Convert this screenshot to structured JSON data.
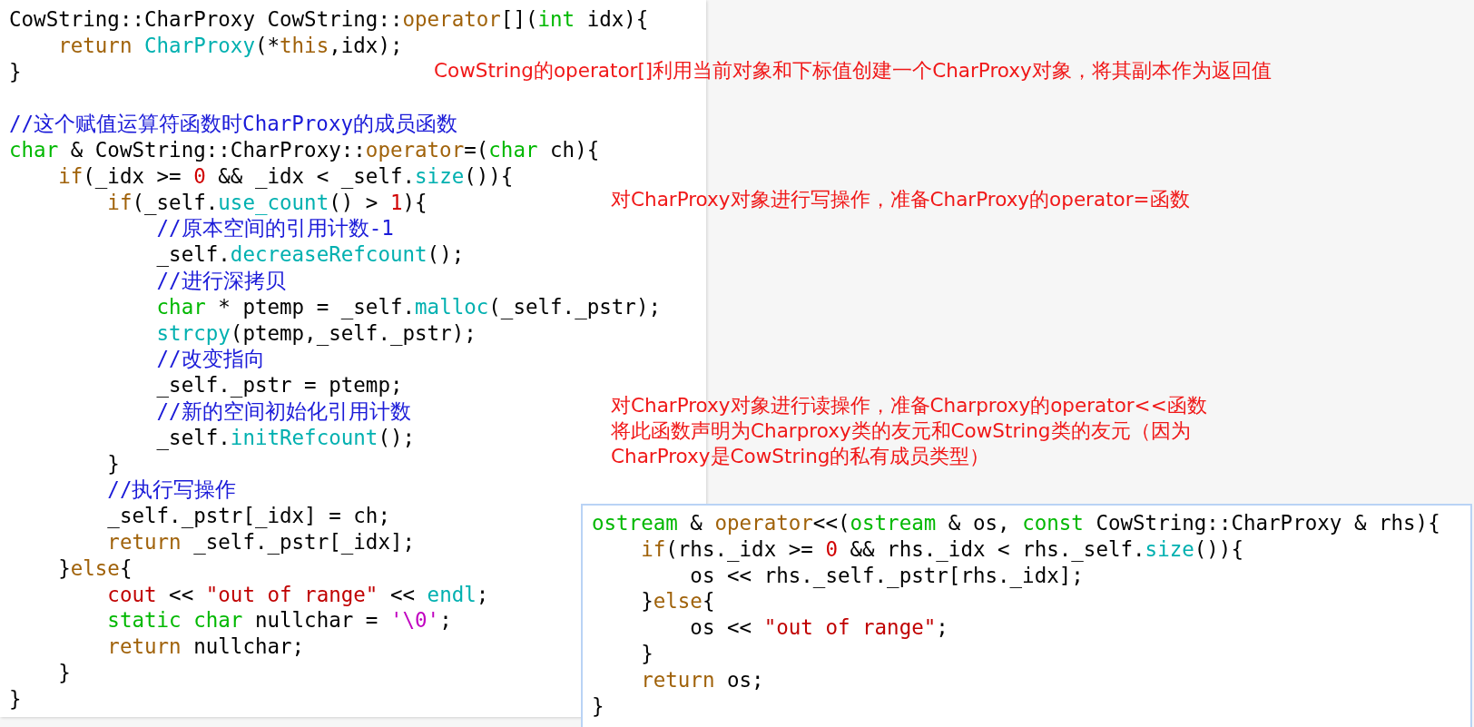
{
  "code_panels": [
    {
      "lines": [
        {
          "kind": "code",
          "tokens": [
            {
              "kind": "plain",
              "text": "CowString::CharProxy CowString::"
            },
            {
              "kind": "keyword",
              "text": "operator"
            },
            {
              "kind": "plain",
              "text": "[]("
            },
            {
              "kind": "type",
              "text": "int"
            },
            {
              "kind": "plain",
              "text": " idx){"
            }
          ]
        },
        {
          "kind": "code",
          "tokens": [
            {
              "kind": "keyword",
              "text": "    return"
            },
            {
              "kind": "func",
              "text": " CharProxy"
            },
            {
              "kind": "plain",
              "text": "(*"
            },
            {
              "kind": "keyword",
              "text": "this"
            },
            {
              "kind": "plain",
              "text": ",idx);"
            }
          ]
        },
        {
          "kind": "code",
          "tokens": [
            {
              "kind": "plain",
              "text": "}"
            }
          ]
        },
        {
          "kind": "blank"
        },
        {
          "kind": "code",
          "tokens": [
            {
              "kind": "comment",
              "text": "//这个赋值运算符函数时CharProxy的成员函数"
            }
          ]
        },
        {
          "kind": "code",
          "tokens": [
            {
              "kind": "type",
              "text": "char"
            },
            {
              "kind": "plain",
              "text": " & CowString::CharProxy::"
            },
            {
              "kind": "keyword",
              "text": "operator"
            },
            {
              "kind": "plain",
              "text": "=("
            },
            {
              "kind": "type",
              "text": "char"
            },
            {
              "kind": "plain",
              "text": " ch){"
            }
          ]
        },
        {
          "kind": "code",
          "tokens": [
            {
              "kind": "keyword",
              "text": "    if"
            },
            {
              "kind": "plain",
              "text": "(_idx >= "
            },
            {
              "kind": "number",
              "text": "0"
            },
            {
              "kind": "plain",
              "text": " && _idx < _self."
            },
            {
              "kind": "func",
              "text": "size"
            },
            {
              "kind": "plain",
              "text": "()){"
            }
          ]
        },
        {
          "kind": "code",
          "tokens": [
            {
              "kind": "keyword",
              "text": "        if"
            },
            {
              "kind": "plain",
              "text": "(_self."
            },
            {
              "kind": "func",
              "text": "use_count"
            },
            {
              "kind": "plain",
              "text": "() > "
            },
            {
              "kind": "number",
              "text": "1"
            },
            {
              "kind": "plain",
              "text": "){"
            }
          ]
        },
        {
          "kind": "code",
          "tokens": [
            {
              "kind": "comment",
              "text": "            //原本空间的引用计数-1"
            }
          ]
        },
        {
          "kind": "code",
          "tokens": [
            {
              "kind": "plain",
              "text": "            _self."
            },
            {
              "kind": "func",
              "text": "decreaseRefcount"
            },
            {
              "kind": "plain",
              "text": "();"
            }
          ]
        },
        {
          "kind": "code",
          "tokens": [
            {
              "kind": "comment",
              "text": "            //进行深拷贝"
            }
          ]
        },
        {
          "kind": "code",
          "tokens": [
            {
              "kind": "type",
              "text": "            char"
            },
            {
              "kind": "plain",
              "text": " * ptemp = _self."
            },
            {
              "kind": "func",
              "text": "malloc"
            },
            {
              "kind": "plain",
              "text": "(_self._pstr);"
            }
          ]
        },
        {
          "kind": "code",
          "tokens": [
            {
              "kind": "func",
              "text": "            strcpy"
            },
            {
              "kind": "plain",
              "text": "(ptemp,_self._pstr);"
            }
          ]
        },
        {
          "kind": "code",
          "tokens": [
            {
              "kind": "comment",
              "text": "            //改变指向"
            }
          ]
        },
        {
          "kind": "code",
          "tokens": [
            {
              "kind": "plain",
              "text": "            _self._pstr = ptemp;"
            }
          ]
        },
        {
          "kind": "code",
          "tokens": [
            {
              "kind": "comment",
              "text": "            //新的空间初始化引用计数"
            }
          ]
        },
        {
          "kind": "code",
          "tokens": [
            {
              "kind": "plain",
              "text": "            _self."
            },
            {
              "kind": "func",
              "text": "initRefcount"
            },
            {
              "kind": "plain",
              "text": "();"
            }
          ]
        },
        {
          "kind": "code",
          "tokens": [
            {
              "kind": "plain",
              "text": "        }"
            }
          ]
        },
        {
          "kind": "code",
          "tokens": [
            {
              "kind": "comment",
              "text": "        //执行写操作"
            }
          ]
        },
        {
          "kind": "code",
          "tokens": [
            {
              "kind": "plain",
              "text": "        _self._pstr[_idx] = ch;"
            }
          ]
        },
        {
          "kind": "code",
          "tokens": [
            {
              "kind": "keyword",
              "text": "        return"
            },
            {
              "kind": "plain",
              "text": " _self._pstr[_idx];"
            }
          ]
        },
        {
          "kind": "code",
          "tokens": [
            {
              "kind": "plain",
              "text": "    }"
            },
            {
              "kind": "keyword",
              "text": "else"
            },
            {
              "kind": "plain",
              "text": "{"
            }
          ]
        },
        {
          "kind": "code",
          "tokens": [
            {
              "kind": "builtin",
              "text": "        cout"
            },
            {
              "kind": "plain",
              "text": " << "
            },
            {
              "kind": "string",
              "text": "\"out of range\""
            },
            {
              "kind": "plain",
              "text": " << "
            },
            {
              "kind": "func",
              "text": "endl"
            },
            {
              "kind": "plain",
              "text": ";"
            }
          ]
        },
        {
          "kind": "code",
          "tokens": [
            {
              "kind": "type",
              "text": "        static"
            },
            {
              "kind": "type",
              "text": " char"
            },
            {
              "kind": "plain",
              "text": " nullchar = "
            },
            {
              "kind": "char",
              "text": "'\\0'"
            },
            {
              "kind": "plain",
              "text": ";"
            }
          ]
        },
        {
          "kind": "code",
          "tokens": [
            {
              "kind": "keyword",
              "text": "        return"
            },
            {
              "kind": "plain",
              "text": " nullchar;"
            }
          ]
        },
        {
          "kind": "code",
          "tokens": [
            {
              "kind": "plain",
              "text": "    }"
            }
          ]
        },
        {
          "kind": "code",
          "tokens": [
            {
              "kind": "plain",
              "text": "}"
            }
          ]
        }
      ]
    },
    {
      "lines": [
        {
          "kind": "code",
          "tokens": [
            {
              "kind": "type",
              "text": "ostream"
            },
            {
              "kind": "plain",
              "text": " & "
            },
            {
              "kind": "keyword",
              "text": "operator"
            },
            {
              "kind": "plain",
              "text": "<<("
            },
            {
              "kind": "type",
              "text": "ostream"
            },
            {
              "kind": "plain",
              "text": " & os, "
            },
            {
              "kind": "type",
              "text": "const"
            },
            {
              "kind": "plain",
              "text": " CowString::CharProxy & rhs){"
            }
          ]
        },
        {
          "kind": "code",
          "tokens": [
            {
              "kind": "keyword",
              "text": "    if"
            },
            {
              "kind": "plain",
              "text": "(rhs._idx >= "
            },
            {
              "kind": "number",
              "text": "0"
            },
            {
              "kind": "plain",
              "text": " && rhs._idx < rhs._self."
            },
            {
              "kind": "func",
              "text": "size"
            },
            {
              "kind": "plain",
              "text": "()){"
            }
          ]
        },
        {
          "kind": "code",
          "tokens": [
            {
              "kind": "plain",
              "text": "        os << rhs._self._pstr[rhs._idx];"
            }
          ]
        },
        {
          "kind": "code",
          "tokens": [
            {
              "kind": "plain",
              "text": "    }"
            },
            {
              "kind": "keyword",
              "text": "else"
            },
            {
              "kind": "plain",
              "text": "{"
            }
          ]
        },
        {
          "kind": "code",
          "tokens": [
            {
              "kind": "plain",
              "text": "        os << "
            },
            {
              "kind": "string",
              "text": "\"out of range\""
            },
            {
              "kind": "plain",
              "text": ";"
            }
          ]
        },
        {
          "kind": "code",
          "tokens": [
            {
              "kind": "plain",
              "text": "    }"
            }
          ]
        },
        {
          "kind": "code",
          "tokens": [
            {
              "kind": "keyword",
              "text": "    return"
            },
            {
              "kind": "plain",
              "text": " os;"
            }
          ]
        },
        {
          "kind": "code",
          "tokens": [
            {
              "kind": "plain",
              "text": "}"
            }
          ]
        }
      ]
    }
  ],
  "annotations": [
    {
      "lines": [
        "CowString的operator[]利用当前对象和下标值创建一个CharProxy对象，将其副本作为返回值"
      ]
    },
    {
      "lines": [
        "对CharProxy对象进行写操作，准备CharProxy的operator=函数"
      ]
    },
    {
      "lines": [
        "对CharProxy对象进行读操作，准备Charproxy的operator<<函数",
        "将此函数声明为Charproxy类的友元和CowString类的友元（因为",
        "CharProxy是CowString的私有成员类型）"
      ]
    }
  ]
}
